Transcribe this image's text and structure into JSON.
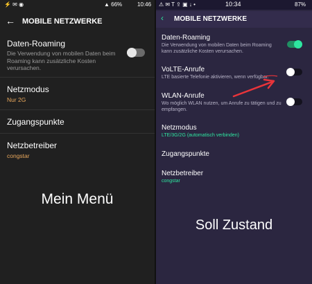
{
  "left": {
    "status": {
      "icons": "⚡ ✉ ◉",
      "signal": "▲ 66%",
      "battery_icon": "battery-icon",
      "time": "10:46"
    },
    "title": "MOBILE NETZWERKE",
    "items": [
      {
        "title": "Daten-Roaming",
        "subtitle": "Die Verwendung von mobilen Daten beim Roaming kann zusätzliche Kosten verursachen.",
        "toggle": "off"
      },
      {
        "title": "Netzmodus",
        "subtitle": "Nur 2G"
      },
      {
        "title": "Zugangspunkte"
      },
      {
        "title": "Netzbetreiber",
        "subtitle": "congstar"
      }
    ],
    "caption": "Mein Menü",
    "colors": {
      "background": "#202020",
      "accent": "#e8a75c",
      "subtext": "#9a9a9a"
    }
  },
  "right": {
    "status": {
      "left": "⚠ ✉ T ⇪ ▣ ↓ •",
      "time": "10:34",
      "right": "87%"
    },
    "title": "MOBILE NETZWERKE",
    "items": [
      {
        "title": "Daten-Roaming",
        "subtitle": "Die Verwendung von mobilen Daten beim Roaming kann zusätzliche Kosten verursachen.",
        "toggle": "on"
      },
      {
        "title": "VoLTE-Anrufe",
        "subtitle": "LTE basierte Telefonie aktivieren, wenn verfügbar.",
        "toggle": "off"
      },
      {
        "title": "WLAN-Anrufe",
        "subtitle": "Wo möglich WLAN nutzen, um Anrufe zu tätigen und zu empfangen.",
        "toggle": "off"
      },
      {
        "title": "Netzmodus",
        "subtitle": "LTE/3G/2G (automatisch verbinden)"
      },
      {
        "title": "Zugangspunkte"
      },
      {
        "title": "Netzbetreiber",
        "subtitle": "congstar"
      }
    ],
    "caption": "Soll Zustand",
    "colors": {
      "background": "#2b2640",
      "accent": "#2ee6a0",
      "subtext": "#b8b4c8",
      "annotation": "#e8343a"
    }
  }
}
